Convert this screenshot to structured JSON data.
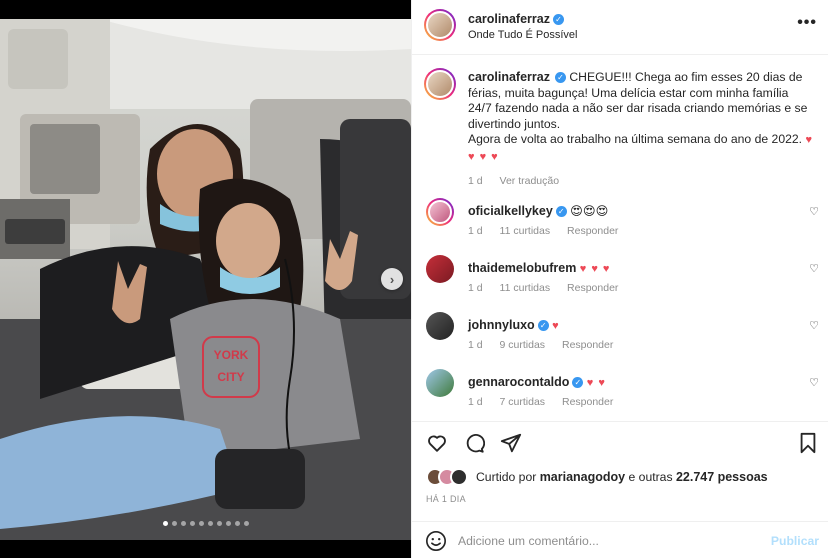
{
  "post": {
    "username": "carolinaferraz",
    "location": "Onde Tudo É Possível",
    "more_icon": "more-options-icon",
    "verified_icon": "verified-badge-icon"
  },
  "media": {
    "shirt_text_1": "YORK",
    "shirt_text_2": "CITY",
    "slide_count": 10,
    "active_slide": 1,
    "next_icon": "chevron-right-icon"
  },
  "caption": {
    "username": "carolinaferraz",
    "text_1": "CHEGUE!!! Chega ao fim esses 20 dias de férias, muita bagunça! Uma delícia estar com minha família 24/7 fazendo nada a não ser dar risada criando memórias e se divertindo juntos.",
    "text_2": "Agora de volta ao trabalho na última semana do ano de 2022.",
    "hearts": "♥ ♥ ♥ ♥",
    "time": "1 d",
    "translate": "Ver tradução"
  },
  "comments": [
    {
      "username": "oficialkellykey",
      "text": "😍😍😍",
      "time": "1 d",
      "likes": "11 curtidas",
      "reply": "Responder",
      "verified": true
    },
    {
      "username": "thaidemelobufrem",
      "text": "♥ ♥ ♥",
      "time": "1 d",
      "likes": "11 curtidas",
      "reply": "Responder",
      "verified": false
    },
    {
      "username": "johnnyluxo",
      "text": "♥",
      "time": "1 d",
      "likes": "9 curtidas",
      "reply": "Responder",
      "verified": true
    },
    {
      "username": "gennarocontaldo",
      "text": "♥ ♥",
      "time": "1 d",
      "likes": "7 curtidas",
      "reply": "Responder",
      "verified": true
    }
  ],
  "actions": {
    "like_icon": "heart-icon",
    "comment_icon": "comment-icon",
    "share_icon": "share-icon",
    "save_icon": "bookmark-icon",
    "liked_by_prefix": "Curtido por",
    "liked_by_user": "marianagodoy",
    "liked_by_suffix": "e outras",
    "like_count": "22.747",
    "liked_by_end": "pessoas",
    "time_ago": "HÁ 1 DIA"
  },
  "add_comment": {
    "placeholder": "Adicione um comentário...",
    "post_label": "Publicar",
    "emoji_icon": "emoji-icon"
  },
  "colors": {
    "verified": "#3897f0",
    "heart_red": "#ed4956",
    "muted": "#8e8e8e",
    "post_button": "#b2dffc"
  }
}
